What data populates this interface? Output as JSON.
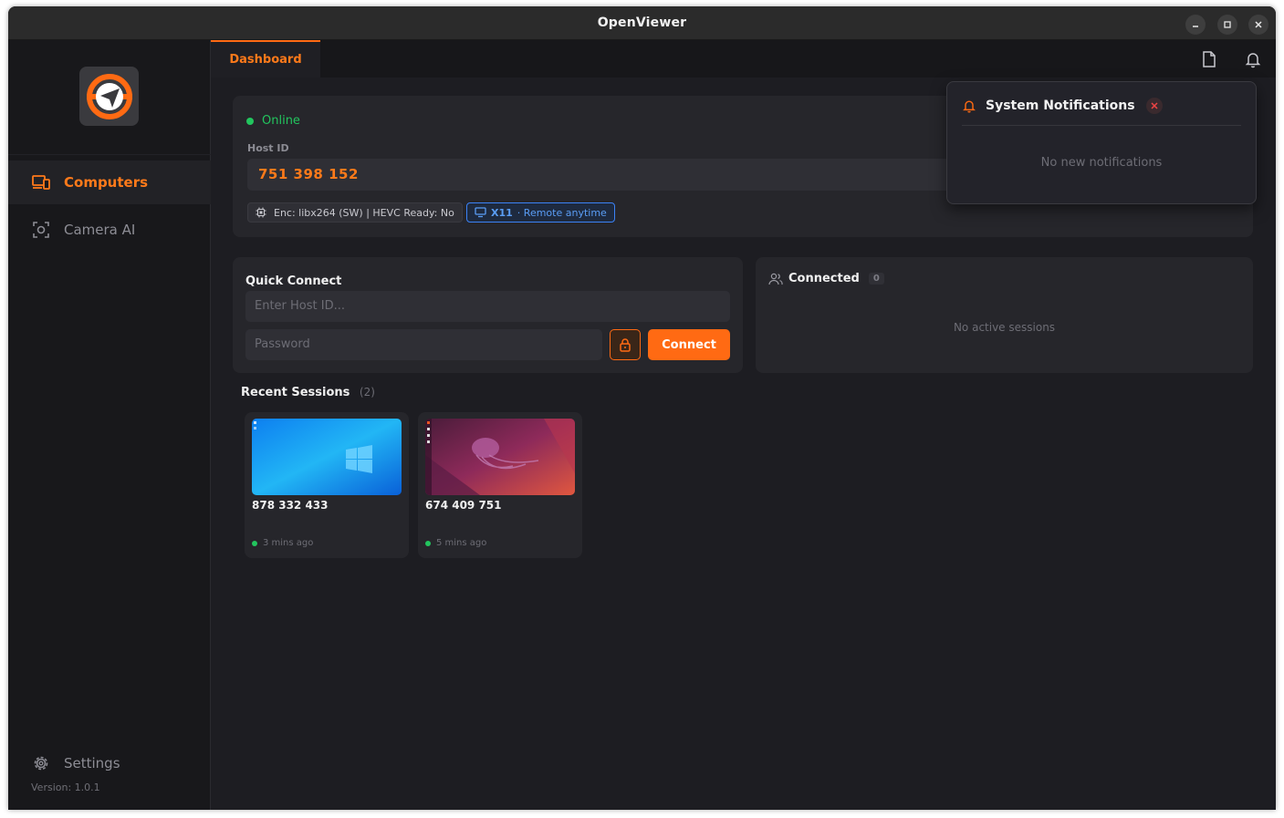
{
  "window": {
    "title": "OpenViewer"
  },
  "sidebar": {
    "items": [
      {
        "label": "Computers",
        "icon": "devices-icon",
        "active": true
      },
      {
        "label": "Camera AI",
        "icon": "camera-focus-icon",
        "active": false
      }
    ],
    "settings_label": "Settings",
    "version": "Version: 1.0.1"
  },
  "tabs": [
    {
      "label": "Dashboard",
      "active": true
    }
  ],
  "host": {
    "status": "Online",
    "id_label": "Host ID",
    "id": "751 398 152",
    "encoder": "Enc: libx264 (SW) | HEVC Ready: No",
    "display_server": "X11",
    "access_mode": "· Remote anytime"
  },
  "quick_connect": {
    "title": "Quick Connect",
    "host_placeholder": "Enter Host ID...",
    "password_placeholder": "Password",
    "connect_label": "Connect"
  },
  "connected": {
    "title": "Connected",
    "count": "0",
    "empty": "No active sessions"
  },
  "recent_sessions": {
    "title": "Recent Sessions",
    "count": "(2)",
    "items": [
      {
        "id": "878 332 433",
        "time": "3 mins ago",
        "thumbnail": "windows-desktop"
      },
      {
        "id": "674 409 751",
        "time": "5 mins ago",
        "thumbnail": "ubuntu-desktop"
      }
    ]
  },
  "notifications": {
    "title": "System Notifications",
    "empty": "No new notifications"
  },
  "colors": {
    "accent": "#ff6a13",
    "online": "#22c55e",
    "info": "#3b82f6"
  }
}
